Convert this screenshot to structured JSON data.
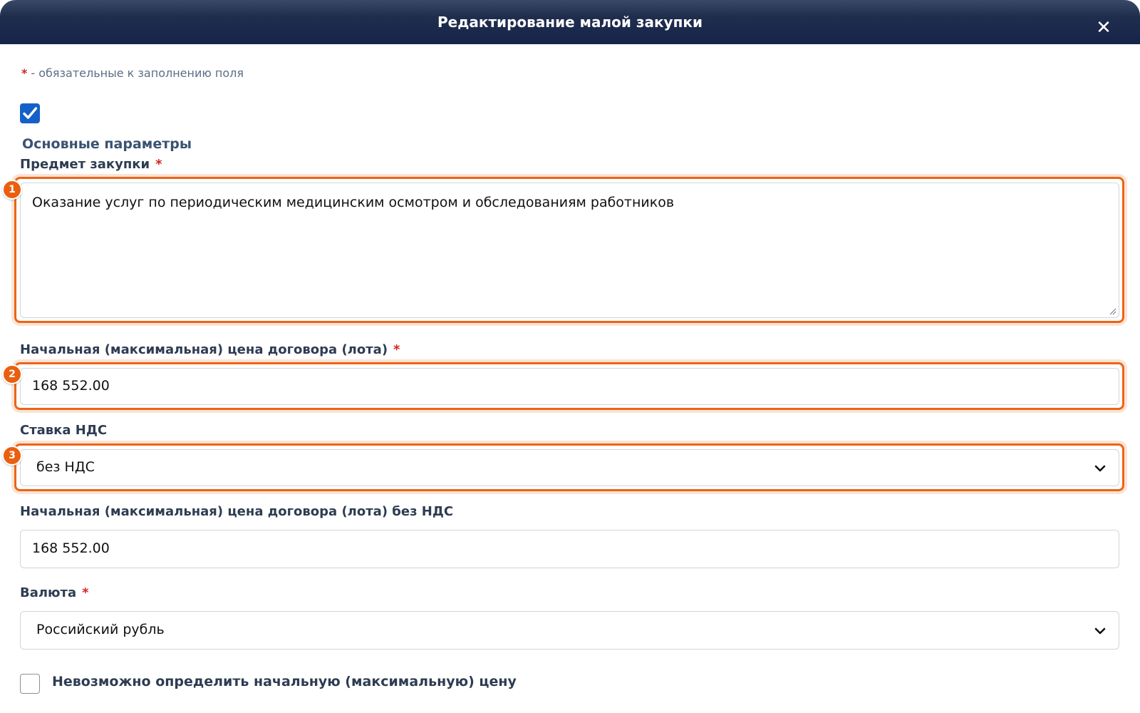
{
  "dialog": {
    "title": "Редактирование малой закупки",
    "close_label": "✕"
  },
  "required_note": {
    "star": "*",
    "text": "- обязательные к заполнению поля"
  },
  "top_checkbox": {
    "checked": true
  },
  "section_title": "Основные параметры",
  "fields": {
    "subject": {
      "label": "Предмет закупки",
      "required_star": "*",
      "value": "Оказание услуг по периодическим медицинским осмотром и обследованиям работников",
      "badge": "1"
    },
    "initial_price": {
      "label": "Начальная (максимальная) цена договора (лота)",
      "required_star": "*",
      "value": "168 552.00",
      "badge": "2"
    },
    "vat_rate": {
      "label": "Ставка НДС",
      "value": "без НДС",
      "badge": "3"
    },
    "price_without_vat": {
      "label": "Начальная (максимальная) цена договора (лота) без НДС",
      "value": "168 552.00"
    },
    "currency": {
      "label": "Валюта",
      "required_star": "*",
      "value": "Российский рубль"
    }
  },
  "undetermined_price": {
    "checked": false,
    "label": "Невозможно определить начальную (максимальную) цену"
  },
  "colors": {
    "header_bg": "#15244a",
    "highlight": "#ec6415",
    "checkbox_blue": "#1560c8",
    "required_star": "#d02626"
  },
  "icons": {
    "close": "close-icon",
    "check": "checkmark-icon",
    "chevron": "chevron-down-icon",
    "resize": "resize-grip-icon"
  }
}
